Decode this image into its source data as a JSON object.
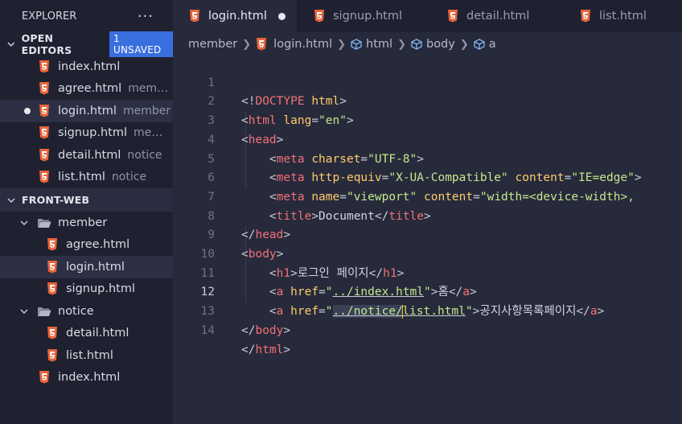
{
  "sidebar": {
    "title": "EXPLORER",
    "more": "···",
    "open_editors": {
      "title": "OPEN EDITORS",
      "badge": "1 UNSAVED",
      "items": [
        {
          "name": "index.html",
          "desc": ""
        },
        {
          "name": "agree.html",
          "desc": "member"
        },
        {
          "name": "login.html",
          "desc": "member"
        },
        {
          "name": "signup.html",
          "desc": "mem..."
        },
        {
          "name": "detail.html",
          "desc": "notice"
        },
        {
          "name": "list.html",
          "desc": "notice"
        }
      ]
    },
    "workspace": {
      "title": "FRONT-WEB",
      "member_folder": "member",
      "member_files": [
        "agree.html",
        "login.html",
        "signup.html"
      ],
      "notice_folder": "notice",
      "notice_files": [
        "detail.html",
        "list.html"
      ],
      "root_files": [
        "index.html"
      ]
    }
  },
  "tabs": [
    {
      "label": "login.html"
    },
    {
      "label": "signup.html"
    },
    {
      "label": "detail.html"
    },
    {
      "label": "list.html"
    }
  ],
  "breadcrumb": [
    "member",
    "login.html",
    "html",
    "body",
    "a"
  ],
  "editor": {
    "line_numbers": [
      "1",
      "2",
      "3",
      "4",
      "5",
      "6",
      "7",
      "8",
      "9",
      "10",
      "11",
      "12",
      "13",
      "14"
    ],
    "l1": {
      "open": "<!",
      "doctype": "DOCTYPE",
      "html": "html",
      "close": ">"
    },
    "l2": {
      "open": "<",
      "tag": "html",
      "attr": "lang",
      "eq": "=",
      "val": "\"en\"",
      "close": ">"
    },
    "l3": {
      "open": "<",
      "tag": "head",
      "close": ">"
    },
    "l4": {
      "open": "<",
      "tag": "meta",
      "attr": "charset",
      "eq": "=",
      "val": "\"UTF-8\"",
      "close": ">"
    },
    "l5": {
      "open": "<",
      "tag": "meta",
      "attr1": "http-equiv",
      "eq1": "=",
      "val1": "\"X-UA-Compatible\"",
      "attr2": "content",
      "eq2": "=",
      "val2": "\"IE=edge\"",
      "close": ">"
    },
    "l6": {
      "open": "<",
      "tag": "meta",
      "attr1": "name",
      "eq1": "=",
      "val1": "\"viewport\"",
      "attr2": "content",
      "eq2": "=",
      "val2": "\"width=<device-width>,"
    },
    "l7": {
      "open": "<",
      "tag": "title",
      "close": ">",
      "text": "Document",
      "copen": "</",
      "ctag": "title",
      "cclose": ">"
    },
    "l8": {
      "open": "</",
      "tag": "head",
      "close": ">"
    },
    "l9": {
      "open": "<",
      "tag": "body",
      "close": ">"
    },
    "l10": {
      "open": "<",
      "tag": "h1",
      "close": ">",
      "text": "로그인 페이지",
      "copen": "</",
      "ctag": "h1",
      "cclose": ">"
    },
    "l11": {
      "open": "<",
      "tag": "a",
      "attr": "href",
      "eq": "=",
      "q1": "\"",
      "path": "../index.html",
      "q2": "\"",
      "close": ">",
      "text": "홈",
      "copen": "</",
      "ctag": "a",
      "cclose": ">"
    },
    "l12": {
      "open": "<",
      "tag": "a",
      "attr": "href",
      "eq": "=",
      "q1": "\"",
      "path_a": "../notice/",
      "path_b": "list.html",
      "q2": "\"",
      "close": ">",
      "text": "공지사항목록페이지",
      "copen": "</",
      "ctag": "a",
      "cclose": ">"
    },
    "l13": {
      "open": "</",
      "tag": "body",
      "close": ">"
    },
    "l14": {
      "open": "</",
      "tag": "html",
      "close": ">"
    }
  },
  "colors": {
    "accent": "#3a6fe0",
    "html_icon": "#e8643a",
    "background": "#272a3b",
    "sidebar": "#1f2130"
  }
}
